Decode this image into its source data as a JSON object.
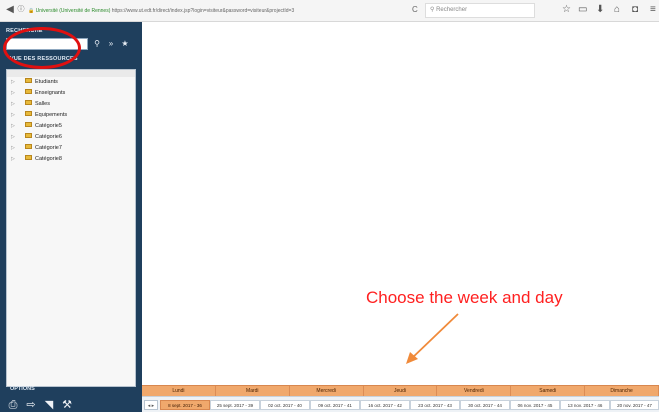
{
  "browser": {
    "url": "https://www.ut.edt.fr/direct/index.jsp?login=visiteur&password=visiteur&projectId=3",
    "site_label": "Université (Université de Rennes)",
    "search_placeholder": "Rechercher"
  },
  "sidebar": {
    "search_title": "RECHERCHE",
    "search_value": "",
    "resources_title": "VUE DES RESSOURCES",
    "tree_items": [
      "Etudiants",
      "Enseignants",
      "Salles",
      "Equipements",
      "Catégorie5",
      "Catégorie6",
      "Catégorie7",
      "Catégorie8"
    ],
    "options_title": "OPTIONS"
  },
  "annotation": "Choose the week and day",
  "days": [
    "Lundi",
    "Mardi",
    "Mercredi",
    "Jeudi",
    "Vendredi",
    "Samedi",
    "Dimanche"
  ],
  "weeks": [
    {
      "label": "8 sept. 2017 - 36",
      "active": true
    },
    {
      "label": "25 sept. 2017 - 39",
      "active": false
    },
    {
      "label": "02 oct. 2017 - 40",
      "active": false
    },
    {
      "label": "09 oct. 2017 - 41",
      "active": false
    },
    {
      "label": "16 oct. 2017 - 42",
      "active": false
    },
    {
      "label": "23 oct. 2017 - 43",
      "active": false
    },
    {
      "label": "30 oct. 2017 - 44",
      "active": false
    },
    {
      "label": "06 nov. 2017 - 45",
      "active": false
    },
    {
      "label": "13 nov. 2017 - 46",
      "active": false
    },
    {
      "label": "20 nov. 2017 - 47",
      "active": false
    }
  ],
  "colors": {
    "sidebar": "#1f3f5d",
    "day_bar": "#f0a86c",
    "annotation": "#ff2020",
    "circle": "#e01010"
  }
}
